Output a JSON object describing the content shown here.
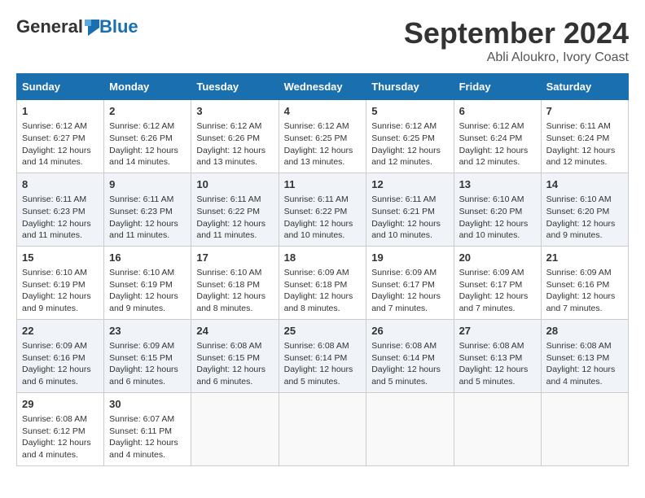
{
  "logo": {
    "general": "General",
    "blue": "Blue"
  },
  "title": "September 2024",
  "location": "Abli Aloukro, Ivory Coast",
  "days_header": [
    "Sunday",
    "Monday",
    "Tuesday",
    "Wednesday",
    "Thursday",
    "Friday",
    "Saturday"
  ],
  "weeks": [
    [
      {
        "day": "1",
        "sunrise": "6:12 AM",
        "sunset": "6:27 PM",
        "daylight": "12 hours and 14 minutes."
      },
      {
        "day": "2",
        "sunrise": "6:12 AM",
        "sunset": "6:26 PM",
        "daylight": "12 hours and 14 minutes."
      },
      {
        "day": "3",
        "sunrise": "6:12 AM",
        "sunset": "6:26 PM",
        "daylight": "12 hours and 13 minutes."
      },
      {
        "day": "4",
        "sunrise": "6:12 AM",
        "sunset": "6:25 PM",
        "daylight": "12 hours and 13 minutes."
      },
      {
        "day": "5",
        "sunrise": "6:12 AM",
        "sunset": "6:25 PM",
        "daylight": "12 hours and 12 minutes."
      },
      {
        "day": "6",
        "sunrise": "6:12 AM",
        "sunset": "6:24 PM",
        "daylight": "12 hours and 12 minutes."
      },
      {
        "day": "7",
        "sunrise": "6:11 AM",
        "sunset": "6:24 PM",
        "daylight": "12 hours and 12 minutes."
      }
    ],
    [
      {
        "day": "8",
        "sunrise": "6:11 AM",
        "sunset": "6:23 PM",
        "daylight": "12 hours and 11 minutes."
      },
      {
        "day": "9",
        "sunrise": "6:11 AM",
        "sunset": "6:23 PM",
        "daylight": "12 hours and 11 minutes."
      },
      {
        "day": "10",
        "sunrise": "6:11 AM",
        "sunset": "6:22 PM",
        "daylight": "12 hours and 11 minutes."
      },
      {
        "day": "11",
        "sunrise": "6:11 AM",
        "sunset": "6:22 PM",
        "daylight": "12 hours and 10 minutes."
      },
      {
        "day": "12",
        "sunrise": "6:11 AM",
        "sunset": "6:21 PM",
        "daylight": "12 hours and 10 minutes."
      },
      {
        "day": "13",
        "sunrise": "6:10 AM",
        "sunset": "6:20 PM",
        "daylight": "12 hours and 10 minutes."
      },
      {
        "day": "14",
        "sunrise": "6:10 AM",
        "sunset": "6:20 PM",
        "daylight": "12 hours and 9 minutes."
      }
    ],
    [
      {
        "day": "15",
        "sunrise": "6:10 AM",
        "sunset": "6:19 PM",
        "daylight": "12 hours and 9 minutes."
      },
      {
        "day": "16",
        "sunrise": "6:10 AM",
        "sunset": "6:19 PM",
        "daylight": "12 hours and 9 minutes."
      },
      {
        "day": "17",
        "sunrise": "6:10 AM",
        "sunset": "6:18 PM",
        "daylight": "12 hours and 8 minutes."
      },
      {
        "day": "18",
        "sunrise": "6:09 AM",
        "sunset": "6:18 PM",
        "daylight": "12 hours and 8 minutes."
      },
      {
        "day": "19",
        "sunrise": "6:09 AM",
        "sunset": "6:17 PM",
        "daylight": "12 hours and 7 minutes."
      },
      {
        "day": "20",
        "sunrise": "6:09 AM",
        "sunset": "6:17 PM",
        "daylight": "12 hours and 7 minutes."
      },
      {
        "day": "21",
        "sunrise": "6:09 AM",
        "sunset": "6:16 PM",
        "daylight": "12 hours and 7 minutes."
      }
    ],
    [
      {
        "day": "22",
        "sunrise": "6:09 AM",
        "sunset": "6:16 PM",
        "daylight": "12 hours and 6 minutes."
      },
      {
        "day": "23",
        "sunrise": "6:09 AM",
        "sunset": "6:15 PM",
        "daylight": "12 hours and 6 minutes."
      },
      {
        "day": "24",
        "sunrise": "6:08 AM",
        "sunset": "6:15 PM",
        "daylight": "12 hours and 6 minutes."
      },
      {
        "day": "25",
        "sunrise": "6:08 AM",
        "sunset": "6:14 PM",
        "daylight": "12 hours and 5 minutes."
      },
      {
        "day": "26",
        "sunrise": "6:08 AM",
        "sunset": "6:14 PM",
        "daylight": "12 hours and 5 minutes."
      },
      {
        "day": "27",
        "sunrise": "6:08 AM",
        "sunset": "6:13 PM",
        "daylight": "12 hours and 5 minutes."
      },
      {
        "day": "28",
        "sunrise": "6:08 AM",
        "sunset": "6:13 PM",
        "daylight": "12 hours and 4 minutes."
      }
    ],
    [
      {
        "day": "29",
        "sunrise": "6:08 AM",
        "sunset": "6:12 PM",
        "daylight": "12 hours and 4 minutes."
      },
      {
        "day": "30",
        "sunrise": "6:07 AM",
        "sunset": "6:11 PM",
        "daylight": "12 hours and 4 minutes."
      },
      null,
      null,
      null,
      null,
      null
    ]
  ]
}
